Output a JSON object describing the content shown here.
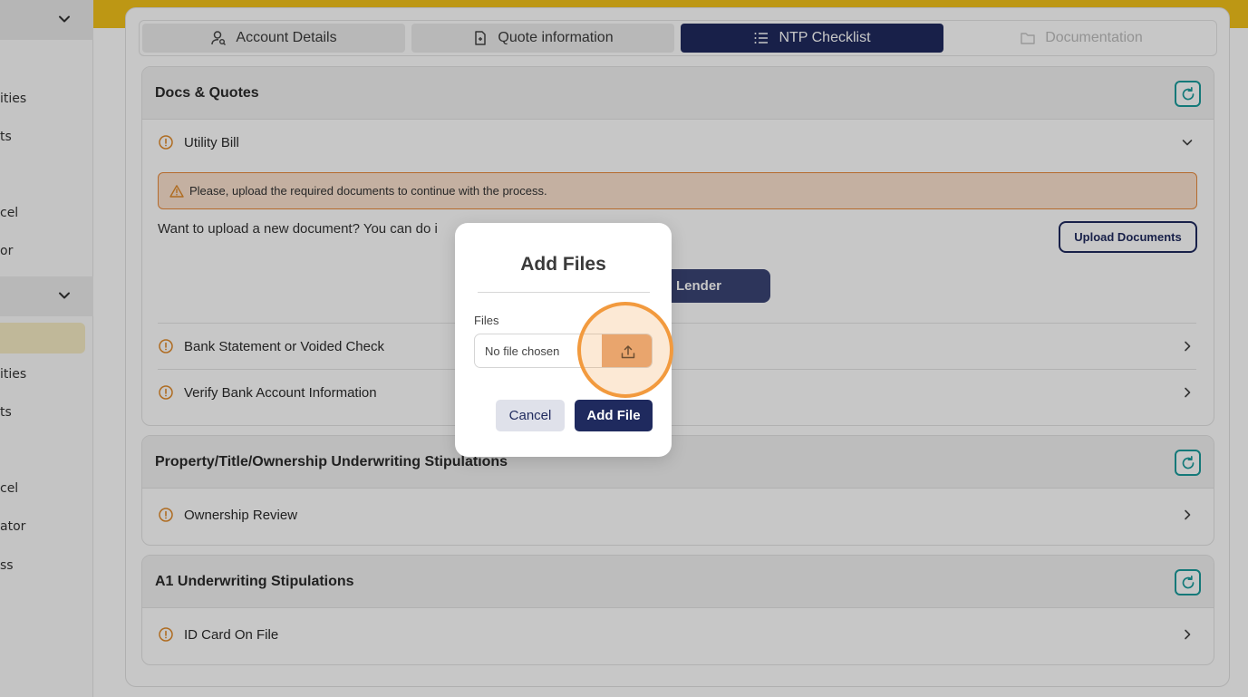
{
  "sidebar": {
    "items": [
      {
        "label": "ities"
      },
      {
        "label": "ts"
      },
      {
        "label": "cel"
      },
      {
        "label": "or"
      },
      {
        "label": "ities"
      },
      {
        "label": "ts"
      },
      {
        "label": "cel"
      },
      {
        "label": "ator"
      },
      {
        "label": "ss"
      }
    ]
  },
  "tabs": [
    {
      "label": "Account Details",
      "icon": "user-search-icon",
      "state": "inactive"
    },
    {
      "label": "Quote information",
      "icon": "document-icon",
      "state": "inactive"
    },
    {
      "label": "NTP Checklist",
      "icon": "list-icon",
      "state": "active"
    },
    {
      "label": "Documentation",
      "icon": "folder-icon",
      "state": "disabled"
    }
  ],
  "sections": {
    "docs_quotes": {
      "title": "Docs & Quotes",
      "items": [
        {
          "label": "Utility Bill"
        },
        {
          "label": "Bank Statement or Voided Check"
        },
        {
          "label": "Verify Bank Account Information"
        }
      ],
      "alert": "Please, upload the required documents to continue with the process.",
      "upload_prompt": "Want to upload a new document? You can do i",
      "upload_button": "Upload Documents",
      "lender_button": "Lender"
    },
    "property": {
      "title": "Property/Title/Ownership Underwriting Stipulations",
      "items": [
        {
          "label": "Ownership Review"
        }
      ]
    },
    "a1": {
      "title": "A1 Underwriting Stipulations",
      "items": [
        {
          "label": "ID Card On File"
        }
      ]
    }
  },
  "modal": {
    "title": "Add Files",
    "files_label": "Files",
    "file_placeholder": "No file chosen",
    "cancel": "Cancel",
    "submit": "Add File"
  },
  "colors": {
    "brand_navy": "#1f2a5e",
    "accent_yellow": "#f2c21a",
    "warning_orange": "#e8893a",
    "refresh_teal": "#1a9b9b",
    "click_highlight": "#f29a3e"
  }
}
